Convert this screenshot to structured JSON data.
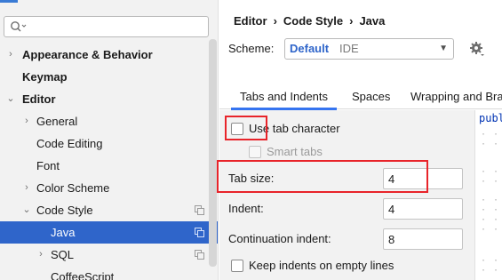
{
  "search": {
    "placeholder": ""
  },
  "sidebar": {
    "items": [
      {
        "label": "Appearance & Behavior",
        "arrow": "›"
      },
      {
        "label": "Keymap"
      },
      {
        "label": "Editor",
        "arrow": "⌄"
      },
      {
        "label": "General",
        "arrow": "›"
      },
      {
        "label": "Code Editing"
      },
      {
        "label": "Font"
      },
      {
        "label": "Color Scheme",
        "arrow": "›"
      },
      {
        "label": "Code Style",
        "arrow": "⌄"
      },
      {
        "label": "Java"
      },
      {
        "label": "SQL",
        "arrow": "›"
      },
      {
        "label": "CoffeeScript"
      }
    ]
  },
  "breadcrumb": {
    "parts": [
      "Editor",
      "Code Style",
      "Java"
    ],
    "separator": "›"
  },
  "scheme": {
    "label": "Scheme:",
    "value": "Default",
    "kind": "IDE"
  },
  "tabs": [
    "Tabs and Indents",
    "Spaces",
    "Wrapping and Bra"
  ],
  "form": {
    "use_tab_character": {
      "label": "Use tab character",
      "checked": false
    },
    "smart_tabs": {
      "label": "Smart tabs",
      "checked": false,
      "disabled": true
    },
    "tab_size": {
      "label": "Tab size:",
      "value": "4"
    },
    "indent": {
      "label": "Indent:",
      "value": "4"
    },
    "continuation_indent": {
      "label": "Continuation indent:",
      "value": "8"
    },
    "keep_indents": {
      "label": "Keep indents on empty lines",
      "checked": false
    }
  },
  "code_preview": {
    "text": "publ"
  },
  "colors": {
    "accent": "#2f65ca",
    "highlight": "#e8242a",
    "tab_underline": "#3574f0"
  }
}
